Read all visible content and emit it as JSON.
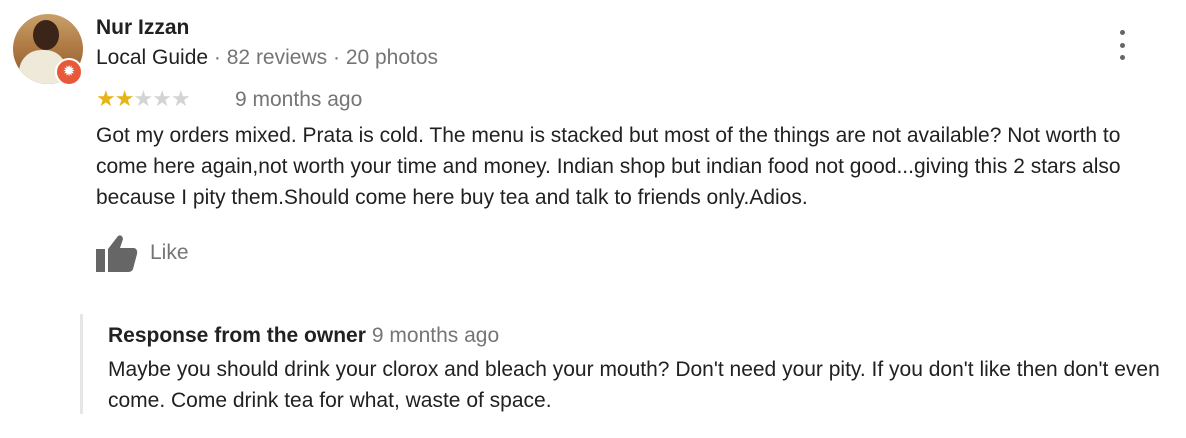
{
  "reviewer": {
    "name": "Nur Izzan",
    "local_guide": "Local Guide",
    "reviews": "82 reviews",
    "photos": "20 photos",
    "separator": " · "
  },
  "rating": {
    "value": 2,
    "max": 5,
    "star_on_color": "#e7b416",
    "star_off_color": "#d4d4d4"
  },
  "review": {
    "time_ago": "9 months ago",
    "text": "Got my orders mixed. Prata is cold. The menu is stacked but most of the things are not available? Not worth to come here again,not worth your time and money. Indian shop but indian food not good...giving this 2 stars also because I pity them.Should come here buy tea and talk to friends only.Adios."
  },
  "actions": {
    "like_label": "Like",
    "like_icon": "thumbs-up-icon",
    "menu_icon": "more-vert-icon"
  },
  "owner_response": {
    "title": "Response from the owner",
    "time_ago": "9 months ago",
    "text": "Maybe you should drink your clorox and bleach your mouth? Don't need your pity. If you don't like then don't even come. Come drink tea for what, waste of space."
  },
  "colors": {
    "badge": "#e8583a",
    "secondary_text": "#757575",
    "primary_text": "#212121"
  }
}
